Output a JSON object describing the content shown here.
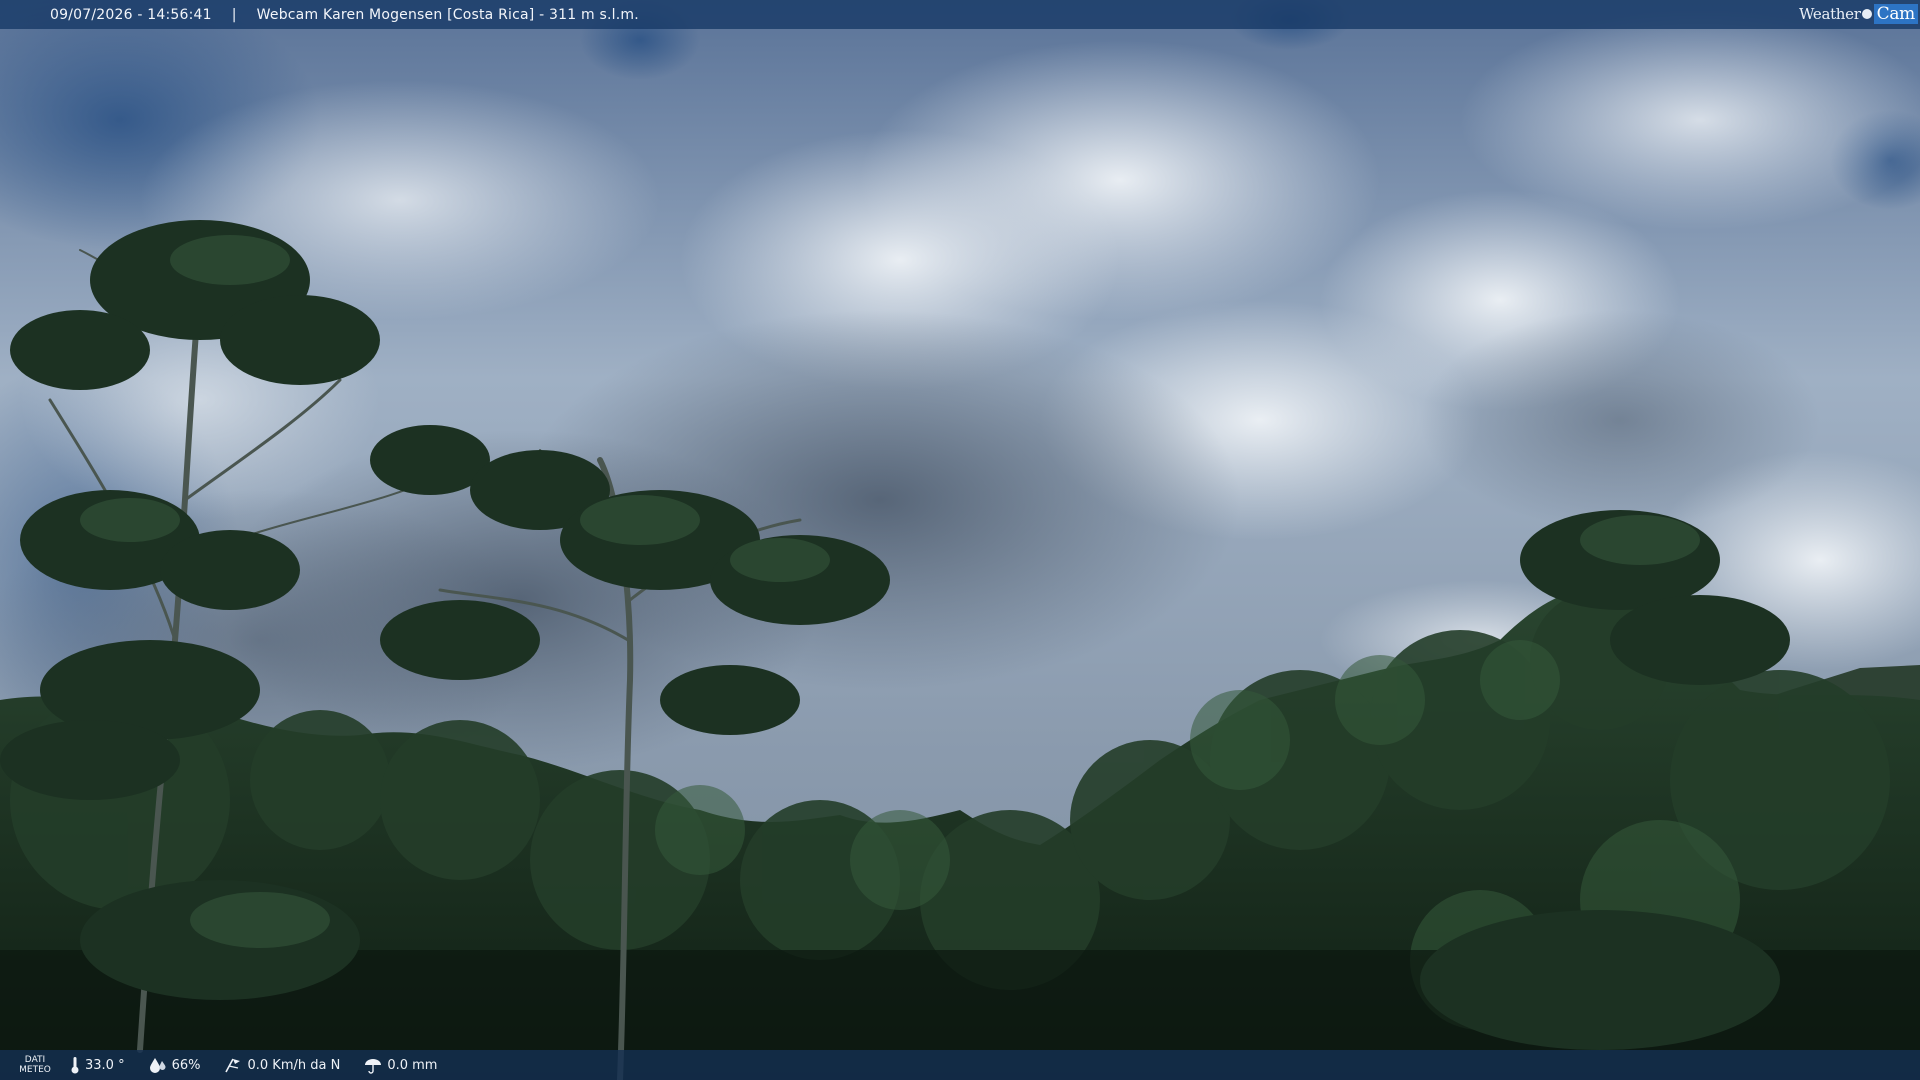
{
  "header": {
    "datetime": "09/07/2026 - 14:56:41",
    "separator": "|",
    "title": "Webcam Karen Mogensen [Costa Rica] - 311 m s.l.m.",
    "logo": {
      "part1": "Weather",
      "part2": "Cam"
    }
  },
  "footer": {
    "dati_line1": "DATI",
    "dati_line2": "METEO",
    "temperature": "33.0 °",
    "humidity": "66%",
    "wind": "0.0 Km/h da N",
    "rain": "0.0 mm"
  },
  "colors": {
    "bar_background": "#183a68",
    "logo_accent": "#2d74c4",
    "sky_blue": "#3d5f8c",
    "foliage_dark": "#14251a"
  },
  "icons": [
    "thermometer-icon",
    "humidity-drop-icon",
    "wind-icon",
    "rain-icon"
  ]
}
